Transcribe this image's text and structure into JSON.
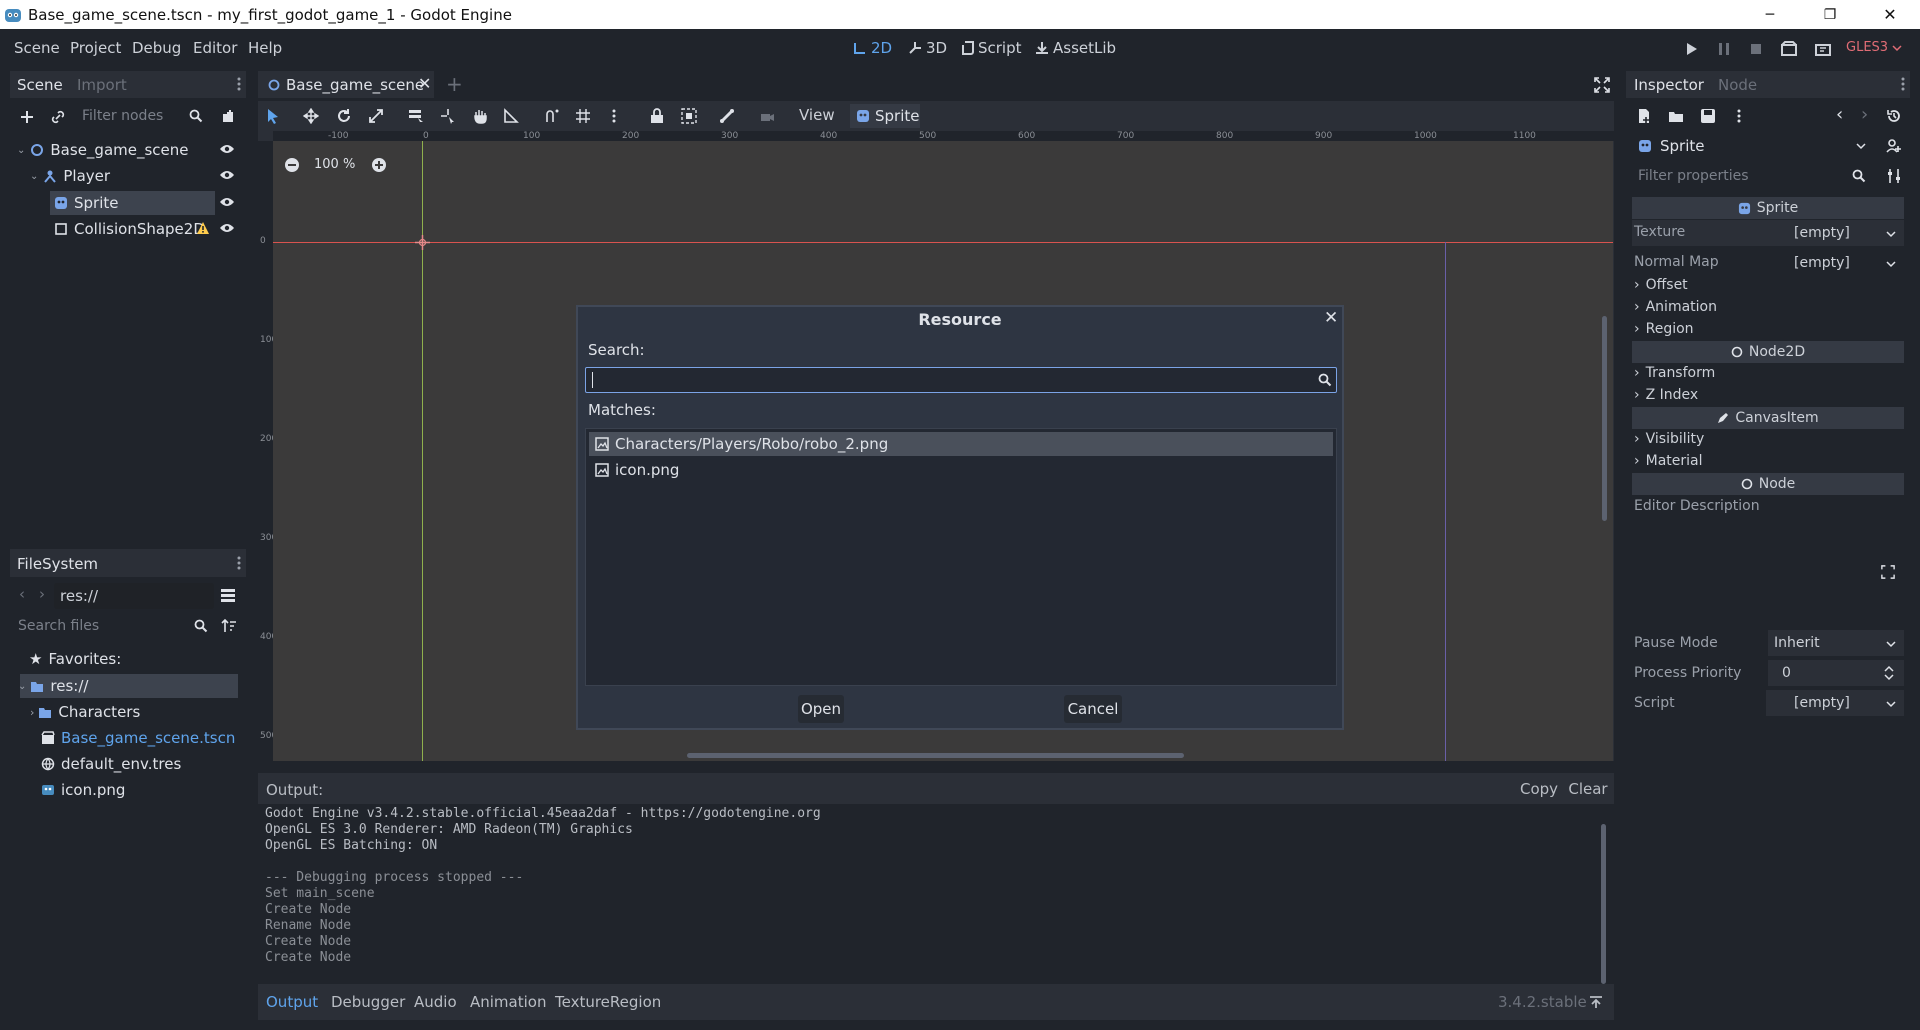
{
  "window": {
    "title": "Base_game_scene.tscn - my_first_godot_game_1 - Godot Engine",
    "minimize_label": "─",
    "maximize_label": "❐",
    "close_label": "✕"
  },
  "menubar": {
    "menus": [
      "Scene",
      "Project",
      "Debug",
      "Editor",
      "Help"
    ],
    "workspaces": {
      "2d": "2D",
      "3d": "3D",
      "script": "Script",
      "assetlib": "AssetLib"
    },
    "renderer": "GLES3"
  },
  "scene_dock": {
    "tab_scene": "Scene",
    "tab_import": "Import",
    "filter_placeholder": "Filter nodes",
    "nodes": [
      "Base_game_scene",
      "Player",
      "Sprite",
      "CollisionShape2D"
    ]
  },
  "filesystem_dock": {
    "tab": "FileSystem",
    "path": "res://",
    "search_placeholder": "Search files",
    "favorites": "Favorites:",
    "items": [
      "res://",
      "Characters",
      "Base_game_scene.tscn",
      "default_env.tres",
      "icon.png"
    ]
  },
  "editor": {
    "scene_tab": "Base_game_scene",
    "zoom": "100 %",
    "view_menu": "View",
    "sprite_menu": "Sprite",
    "ruler_h": [
      "-100",
      "0",
      "100",
      "200",
      "300",
      "400",
      "500",
      "600",
      "700",
      "800",
      "900",
      "1000",
      "1100"
    ],
    "ruler_v": [
      "0",
      "100",
      "200",
      "300",
      "400",
      "500"
    ]
  },
  "dialog": {
    "title": "Resource",
    "search_label": "Search:",
    "matches_label": "Matches:",
    "matches": [
      "Characters/Players/Robo/robo_2.png",
      "icon.png"
    ],
    "open_label": "Open",
    "cancel_label": "Cancel"
  },
  "output": {
    "label": "Output:",
    "copy_label": "Copy",
    "clear_label": "Clear",
    "lines": [
      "Godot Engine v3.4.2.stable.official.45eaa2daf - https://godotengine.org",
      "OpenGL ES 3.0 Renderer: AMD Radeon(TM) Graphics",
      "OpenGL ES Batching: ON",
      "",
      "--- Debugging process stopped ---",
      "Set main_scene",
      "Create Node",
      "Rename Node",
      "Create Node",
      "Create Node"
    ],
    "bottom_tabs": [
      "Output",
      "Debugger",
      "Audio",
      "Animation",
      "TextureRegion"
    ],
    "version": "3.4.2.stable"
  },
  "inspector": {
    "tab_inspector": "Inspector",
    "tab_node": "Node",
    "object_name": "Sprite",
    "filter_placeholder": "Filter properties",
    "section_sprite": "Sprite",
    "texture_label": "Texture",
    "texture_value": "[empty]",
    "normal_map_label": "Normal Map",
    "normal_map_value": "[empty]",
    "sprite_groups": [
      "Offset",
      "Animation",
      "Region"
    ],
    "section_node2d": "Node2D",
    "node2d_groups": [
      "Transform",
      "Z Index"
    ],
    "section_canvasitem": "CanvasItem",
    "canvas_groups": [
      "Visibility",
      "Material"
    ],
    "section_node": "Node",
    "editor_description": "Editor Description",
    "pause_mode_label": "Pause Mode",
    "pause_mode_value": "Inherit",
    "process_priority_label": "Process Priority",
    "process_priority_value": "0",
    "script_label": "Script",
    "script_value": "[empty]"
  },
  "colors": {
    "accent": "#5fa4ec",
    "warning": "#ffcc4d",
    "renderer": "#e06c75",
    "axis_x": "#d9534f",
    "axis_y": "#8fb04d"
  }
}
